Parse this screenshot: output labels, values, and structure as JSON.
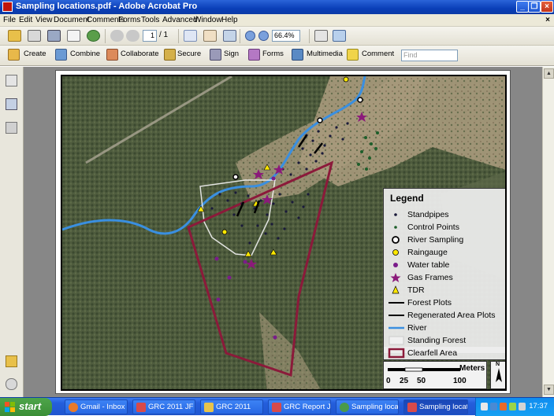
{
  "window": {
    "title": "Sampling locations.pdf - Adobe Acrobat Pro",
    "min_glyph": "_",
    "max_glyph": "❐",
    "close_glyph": "×"
  },
  "menu": [
    "File",
    "Edit",
    "View",
    "Document",
    "Comments",
    "Forms",
    "Tools",
    "Advanced",
    "Window",
    "Help"
  ],
  "menu_close": "×",
  "toolbar1": {
    "page_current": "1",
    "page_total": "/ 1",
    "zoom": "66.4%"
  },
  "toolbar2": {
    "items": [
      "Create",
      "Combine",
      "Collaborate",
      "Secure",
      "Sign",
      "Forms",
      "Multimedia",
      "Comment"
    ],
    "find_placeholder": "Find"
  },
  "legend": {
    "title": "Legend",
    "items": [
      {
        "label": "Standpipes",
        "symbol": "dot",
        "color": "#1a1a3a"
      },
      {
        "label": "Control Points",
        "symbol": "dot",
        "color": "#1d5e2a"
      },
      {
        "label": "River Sampling",
        "symbol": "ring",
        "color": "#000000"
      },
      {
        "label": "Raingauge",
        "symbol": "yellow-circle",
        "color": "#ffe800"
      },
      {
        "label": "Water table",
        "symbol": "purple-dot",
        "color": "#7a1c8a"
      },
      {
        "label": "Gas Frames",
        "symbol": "star",
        "color": "#8b1a7a"
      },
      {
        "label": "TDR",
        "symbol": "triangle",
        "color": "#ffe800"
      },
      {
        "label": "Forest Plots",
        "symbol": "line",
        "color": "#000000"
      },
      {
        "label": "Regenerated Area Plots",
        "symbol": "line",
        "color": "#000000"
      },
      {
        "label": "River",
        "symbol": "line",
        "color": "#3a8fe0"
      },
      {
        "label": "Standing Forest",
        "symbol": "box",
        "color": "#f0f0f0"
      },
      {
        "label": "Clearfell Area",
        "symbol": "box",
        "color": "#8b1a3a"
      }
    ]
  },
  "scale": {
    "unit": "Meters",
    "ticks": [
      "0",
      "25",
      "50",
      "100"
    ]
  },
  "north": "N",
  "taskbar": {
    "start": "start",
    "tasks": [
      "Gmail - Inbox ...",
      "GRC 2011 JF",
      "GRC 2011",
      "GRC Report J...",
      "Sampling locati...",
      "Sampling locati..."
    ],
    "clock": "17:37"
  },
  "colors": {
    "river": "#3a8fe0",
    "clearfell": "#8b1a3a",
    "forest": "#4c5a3a",
    "titlebar": "#0a3fb8"
  }
}
